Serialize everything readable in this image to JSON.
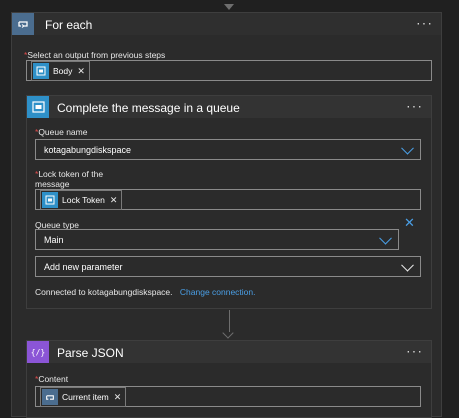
{
  "foreach": {
    "title": "For each",
    "field_label": "Select an output from previous steps",
    "token_label": "Body"
  },
  "complete": {
    "title": "Complete the message in a queue",
    "queue_name": {
      "label": "Queue name",
      "value": "kotagabungdiskspace"
    },
    "lock_token": {
      "label_line1": "Lock token of the",
      "label_line2": "message",
      "token_label": "Lock Token"
    },
    "queue_type": {
      "label": "Queue type",
      "value": "Main"
    },
    "add_param": {
      "label": "Add new parameter"
    },
    "connection": {
      "text": "Connected to kotagabungdiskspace.",
      "link": "Change connection."
    }
  },
  "parse": {
    "title": "Parse JSON",
    "icon_text": "{/}",
    "content_label": "Content",
    "token_label": "Current item"
  },
  "colors": {
    "foreach_icon": "#4b6d8f",
    "servicebus_icon": "#2e90c8",
    "parse_icon": "#8b55d6",
    "required": "#e04b4b",
    "link": "#4a9fe6"
  }
}
